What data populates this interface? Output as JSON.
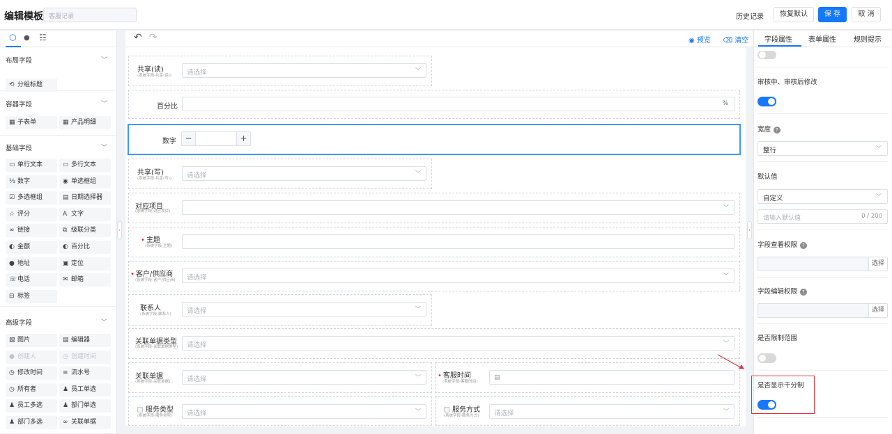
{
  "header": {
    "title": "编辑模板",
    "name_placeholder": "客服记录",
    "history": "历史记录",
    "restore_default": "恢复默认",
    "save": "保 存",
    "cancel": "取 消"
  },
  "left_panel": {
    "groups": [
      {
        "title": "布局字段",
        "items": [
          {
            "icon": "group-title-icon",
            "glyph": "⟲",
            "label": "分组标题",
            "disabled": false
          }
        ]
      },
      {
        "title": "容器字段",
        "items": [
          {
            "icon": "table-icon",
            "glyph": "▦",
            "label": "子表单",
            "disabled": false
          },
          {
            "icon": "table-icon",
            "glyph": "▦",
            "label": "产品明细",
            "disabled": false
          }
        ]
      },
      {
        "title": "基础字段",
        "items": [
          {
            "icon": "single-line-icon",
            "glyph": "▭",
            "label": "单行文本",
            "disabled": false
          },
          {
            "icon": "multi-line-icon",
            "glyph": "▭",
            "label": "多行文本",
            "disabled": false
          },
          {
            "icon": "number-icon",
            "glyph": "⅓",
            "label": "数字",
            "disabled": false
          },
          {
            "icon": "radio-icon",
            "glyph": "◉",
            "label": "单选框组",
            "disabled": false
          },
          {
            "icon": "checkbox-icon",
            "glyph": "☑",
            "label": "多选框组",
            "disabled": false
          },
          {
            "icon": "calendar-icon",
            "glyph": "▤",
            "label": "日期选择器",
            "disabled": false
          },
          {
            "icon": "star-icon",
            "glyph": "☆",
            "label": "评分",
            "disabled": false
          },
          {
            "icon": "text-icon",
            "glyph": "A",
            "label": "文字",
            "disabled": false
          },
          {
            "icon": "link-icon",
            "glyph": "∞",
            "label": "链接",
            "disabled": false
          },
          {
            "icon": "cascade-icon",
            "glyph": "⧉",
            "label": "级联分类",
            "disabled": false
          },
          {
            "icon": "amount-icon",
            "glyph": "◐",
            "label": "金额",
            "disabled": false
          },
          {
            "icon": "percent-icon",
            "glyph": "◐",
            "label": "百分比",
            "disabled": false
          },
          {
            "icon": "location-pin-icon",
            "glyph": "●",
            "label": "地址",
            "disabled": false
          },
          {
            "icon": "position-icon",
            "glyph": "▣",
            "label": "定位",
            "disabled": false
          },
          {
            "icon": "phone-icon",
            "glyph": "☏",
            "label": "电话",
            "disabled": false
          },
          {
            "icon": "mail-icon",
            "glyph": "✉",
            "label": "邮箱",
            "disabled": false
          },
          {
            "icon": "tag-icon",
            "glyph": "⊟",
            "label": "标签",
            "disabled": false
          }
        ]
      },
      {
        "title": "高级字段",
        "items": [
          {
            "icon": "image-icon",
            "glyph": "▨",
            "label": "图片",
            "disabled": false
          },
          {
            "icon": "editor-icon",
            "glyph": "▤",
            "label": "编辑器",
            "disabled": false
          },
          {
            "icon": "user-icon",
            "glyph": "●",
            "label": "创建人",
            "disabled": true
          },
          {
            "icon": "clock-icon",
            "glyph": "◷",
            "label": "创建时间",
            "disabled": true
          },
          {
            "icon": "clock-icon",
            "glyph": "◷",
            "label": "修改时间",
            "disabled": false
          },
          {
            "icon": "serial-icon",
            "glyph": "≡",
            "label": "流水号",
            "disabled": false
          },
          {
            "icon": "clock-icon",
            "glyph": "◷",
            "label": "所有者",
            "disabled": false
          },
          {
            "icon": "users-icon",
            "glyph": "♟",
            "label": "员工单选",
            "disabled": false
          },
          {
            "icon": "users-icon",
            "glyph": "♟",
            "label": "员工多选",
            "disabled": false
          },
          {
            "icon": "users-icon",
            "glyph": "♟",
            "label": "部门单选",
            "disabled": false
          },
          {
            "icon": "users-icon",
            "glyph": "♟",
            "label": "部门多选",
            "disabled": false
          },
          {
            "icon": "link-icon",
            "glyph": "∞",
            "label": "关联单据",
            "disabled": false
          }
        ]
      }
    ]
  },
  "toolbar": {
    "preview": "预览",
    "clear": "清空"
  },
  "canvas": {
    "placeholder_select": "请选择",
    "fields": {
      "shared_read": {
        "label": "共享(读)",
        "sub": "(系统字段-共享(读))"
      },
      "percent": {
        "label": "百分比",
        "suffix": "%"
      },
      "number": {
        "label": "数字",
        "minus": "−",
        "plus": "+"
      },
      "shared_write": {
        "label": "共享(写)",
        "sub": "(系统字段-共享(写))"
      },
      "project": {
        "label": "对应项目",
        "sub": "(系统字段-对应项目)"
      },
      "subject": {
        "label": "主题",
        "sub": "(系统字段-主题)"
      },
      "customer": {
        "label": "客户/供应商",
        "sub": "(系统字段-客户/供应商)"
      },
      "contact": {
        "label": "联系人",
        "sub": "(系统字段-联系人)"
      },
      "doc_type": {
        "label": "关联单据类型",
        "sub": "(系统字段-关联单据类型)"
      },
      "doc": {
        "label": "关联单据",
        "sub": "(系统字段-关联单据)"
      },
      "service_time": {
        "label": "客服时间",
        "sub": "(系统字段-客服时间)"
      },
      "service_type": {
        "label": "服务类型",
        "sub": "(系统字段-服务类型)"
      },
      "service_mode": {
        "label": "服务方式",
        "sub": "(系统字段-服务方式)"
      }
    }
  },
  "right_panel": {
    "tabs": [
      "字段属性",
      "表单属性",
      "规则提示"
    ],
    "active_tab": "字段属性",
    "review_edit_label": "审核中、审核后修改",
    "review_edit_on": true,
    "width_label": "宽度",
    "width_value": "整行",
    "default_label": "默认值",
    "default_mode": "自定义",
    "default_placeholder": "请输入默认值",
    "default_count": "0 / 200",
    "view_perm_label": "字段查看权限",
    "edit_perm_label": "字段编辑权限",
    "pick_label": "选择",
    "limit_range_label": "是否限制范围",
    "limit_range_on": false,
    "thousands_label": "是否显示千分制",
    "thousands_on": true
  }
}
